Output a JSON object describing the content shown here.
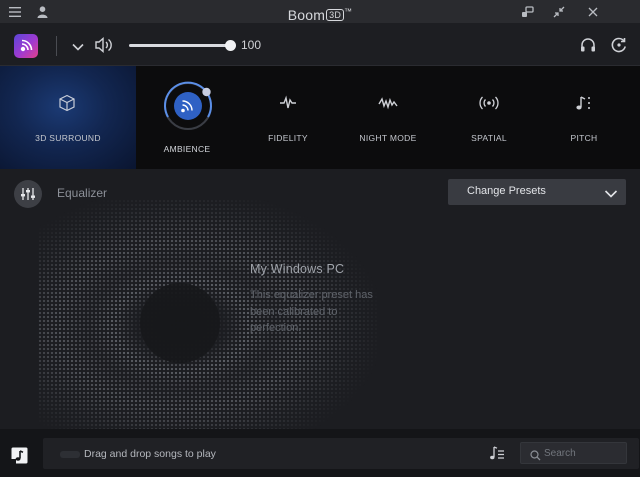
{
  "window": {
    "title": "Boom",
    "title_badge": "3D",
    "title_mark": "™"
  },
  "toolbar": {
    "volume_value": "100",
    "volume_level": 1.0
  },
  "effects": {
    "items": [
      {
        "id": "3d-surround",
        "label": "3D SURROUND",
        "active": true
      },
      {
        "id": "ambience",
        "label": "AMBIENCE",
        "active": false
      },
      {
        "id": "fidelity",
        "label": "FIDELITY",
        "active": false
      },
      {
        "id": "night-mode",
        "label": "NIGHT MODE",
        "active": false
      },
      {
        "id": "spatial",
        "label": "SPATIAL",
        "active": false
      },
      {
        "id": "pitch",
        "label": "PITCH",
        "active": false
      }
    ]
  },
  "equalizer": {
    "title": "Equalizer",
    "presets_label": "Change Presets",
    "preset_name": "My Windows PC",
    "preset_description": "This equalizer preset has been calibrated to perfection."
  },
  "bottom": {
    "drop_label": "Drag and drop songs to play",
    "search_placeholder": "Search"
  },
  "colors": {
    "accent_blue": "#1e4fa8",
    "ambience_ring": "#5b8fe8",
    "background": "#1b1c20"
  }
}
